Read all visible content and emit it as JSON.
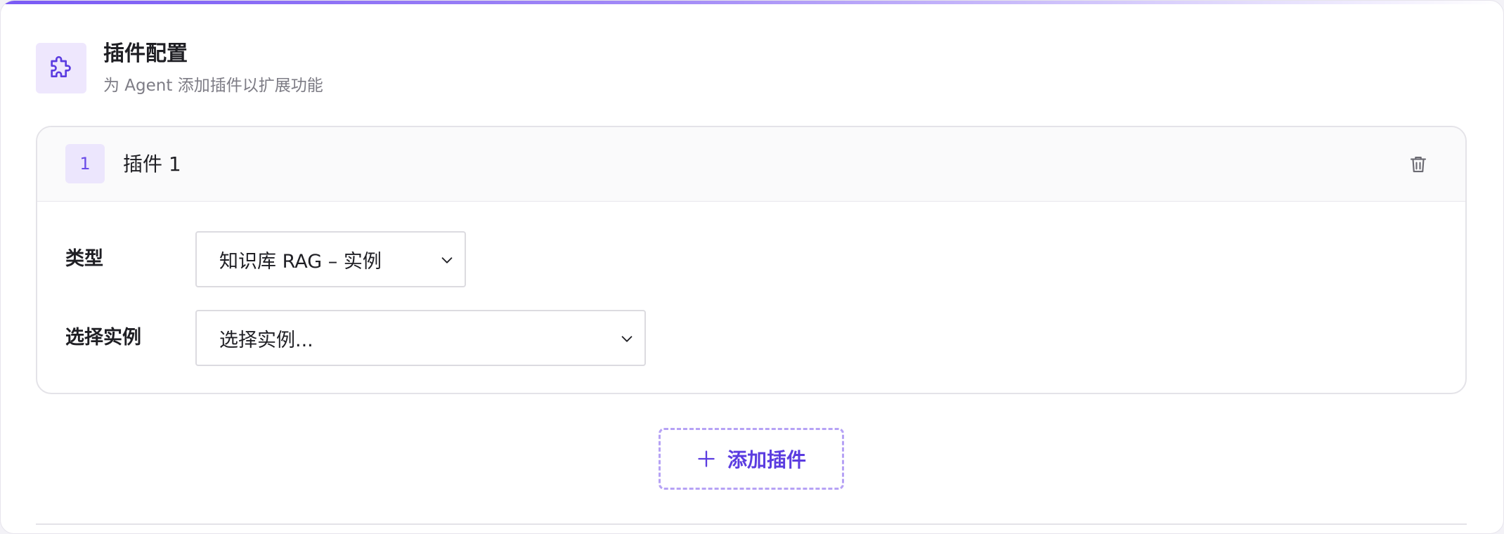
{
  "header": {
    "icon": "puzzle-icon",
    "title": "插件配置",
    "subtitle": "为 Agent 添加插件以扩展功能"
  },
  "plugins": [
    {
      "index": "1",
      "title": "插件 1",
      "delete_icon": "trash-icon",
      "fields": {
        "type_label": "类型",
        "type_value": "知识库 RAG – 实例",
        "instance_label": "选择实例",
        "instance_placeholder": "选择实例..."
      }
    }
  ],
  "add_button": {
    "icon": "plus-icon",
    "label": "添加插件"
  },
  "colors": {
    "accent": "#6a4ce8",
    "accent_light": "#ece6fd",
    "dashed_border": "#b6a2f5"
  }
}
